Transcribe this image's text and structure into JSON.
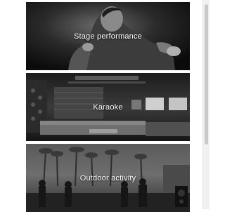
{
  "gallery": {
    "items": [
      {
        "label": "Stage performance"
      },
      {
        "label": "Karaoke"
      },
      {
        "label": "Outdoor activity"
      }
    ]
  }
}
